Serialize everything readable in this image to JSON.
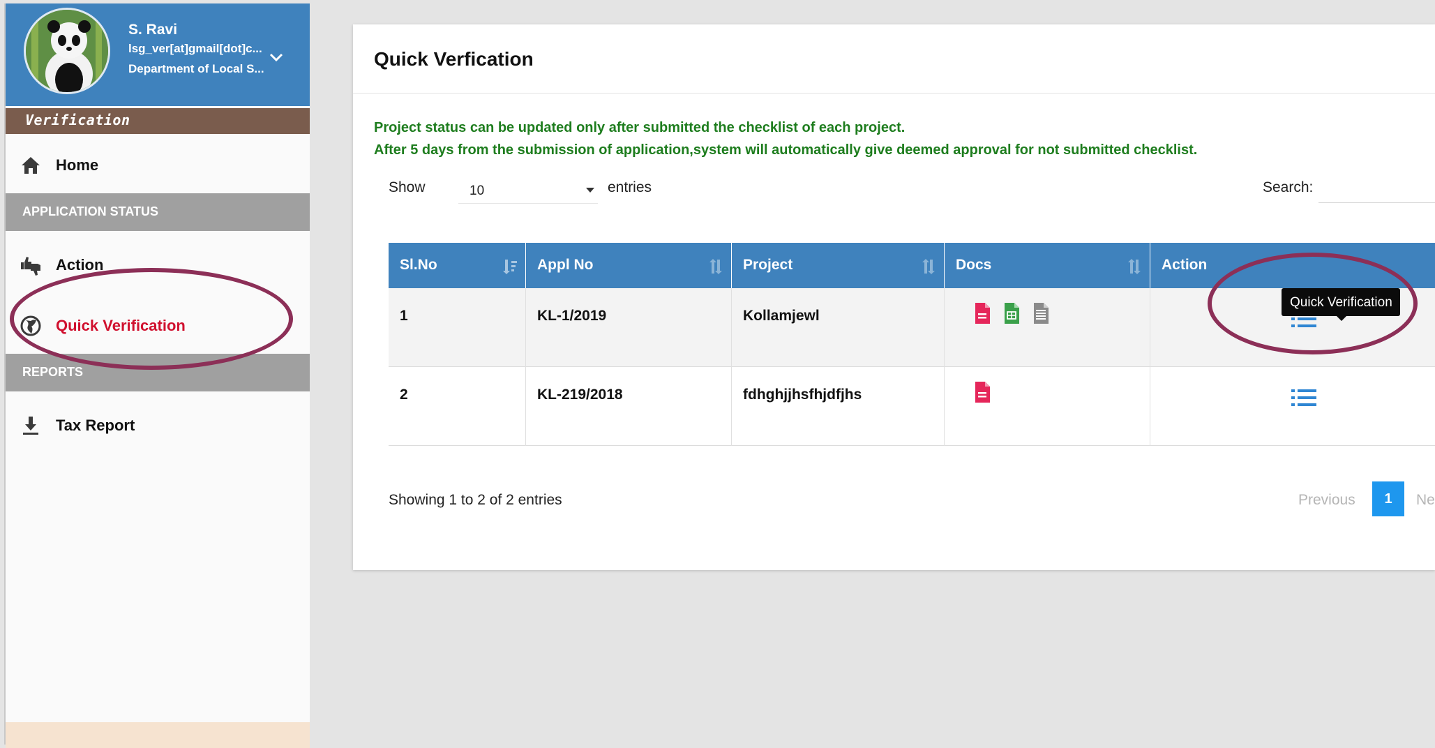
{
  "sidebar": {
    "profile": {
      "name": "S. Ravi",
      "email": "lsg_ver[at]gmail[dot]c...",
      "department": "Department of Local S..."
    },
    "role": "Verification",
    "items": [
      {
        "label": "Home",
        "icon": "home-icon"
      },
      {
        "label": "Action",
        "icon": "thumbs-up-down-icon"
      },
      {
        "label": "Quick Verification",
        "icon": "globe-icon",
        "active": true
      },
      {
        "label": "Tax Report",
        "icon": "download-icon"
      }
    ],
    "sections": {
      "application_status": "APPLICATION STATUS",
      "reports": "REPORTS"
    }
  },
  "main": {
    "title": "Quick Verfication",
    "notices": [
      "Project status can be updated only after submitted the checklist of each project.",
      "After 5 days from the submission of application,system will automatically give deemed approval for not submitted checklist."
    ],
    "length_control": {
      "show_label": "Show",
      "value": "10",
      "entries_label": "entries"
    },
    "search": {
      "label": "Search:",
      "value": ""
    },
    "table": {
      "columns": [
        "Sl.No",
        "Appl No",
        "Project",
        "Docs",
        "Action"
      ],
      "rows": [
        {
          "sl": "1",
          "appl_no": "KL-1/2019",
          "project": "Kollamjewl",
          "docs": [
            "pdf-doc-icon",
            "spreadsheet-doc-icon",
            "text-doc-icon"
          ]
        },
        {
          "sl": "2",
          "appl_no": "KL-219/2018",
          "project": "fdhghjjhsfhjdfjhs",
          "docs": [
            "pdf-doc-icon"
          ]
        }
      ]
    },
    "tooltip": "Quick Verification",
    "info": "Showing 1 to 2 of 2 entries",
    "pagination": {
      "previous": "Previous",
      "current": "1",
      "next": "Ne"
    }
  },
  "colors": {
    "header_blue": "#3f82bd",
    "role_bar": "#7a5c4d",
    "active_link": "#d0102e",
    "notice_green": "#1e7d1e",
    "annotation": "#8c2f57",
    "pdf": "#e5265a",
    "sheet": "#3aa04a",
    "page_active": "#1e97ee"
  }
}
